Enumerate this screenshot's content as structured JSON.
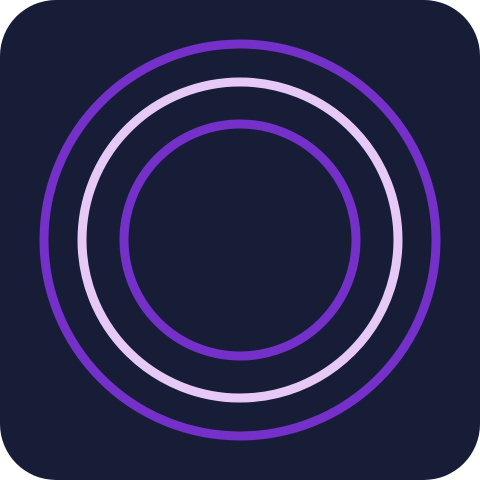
{
  "icon": {
    "name": "concentric-rings-app-icon",
    "colors": {
      "background": "#171d36",
      "outer_ring": "#7430c9",
      "middle_ring": "#e6c9f7",
      "inner_ring": "#7430c9"
    }
  }
}
